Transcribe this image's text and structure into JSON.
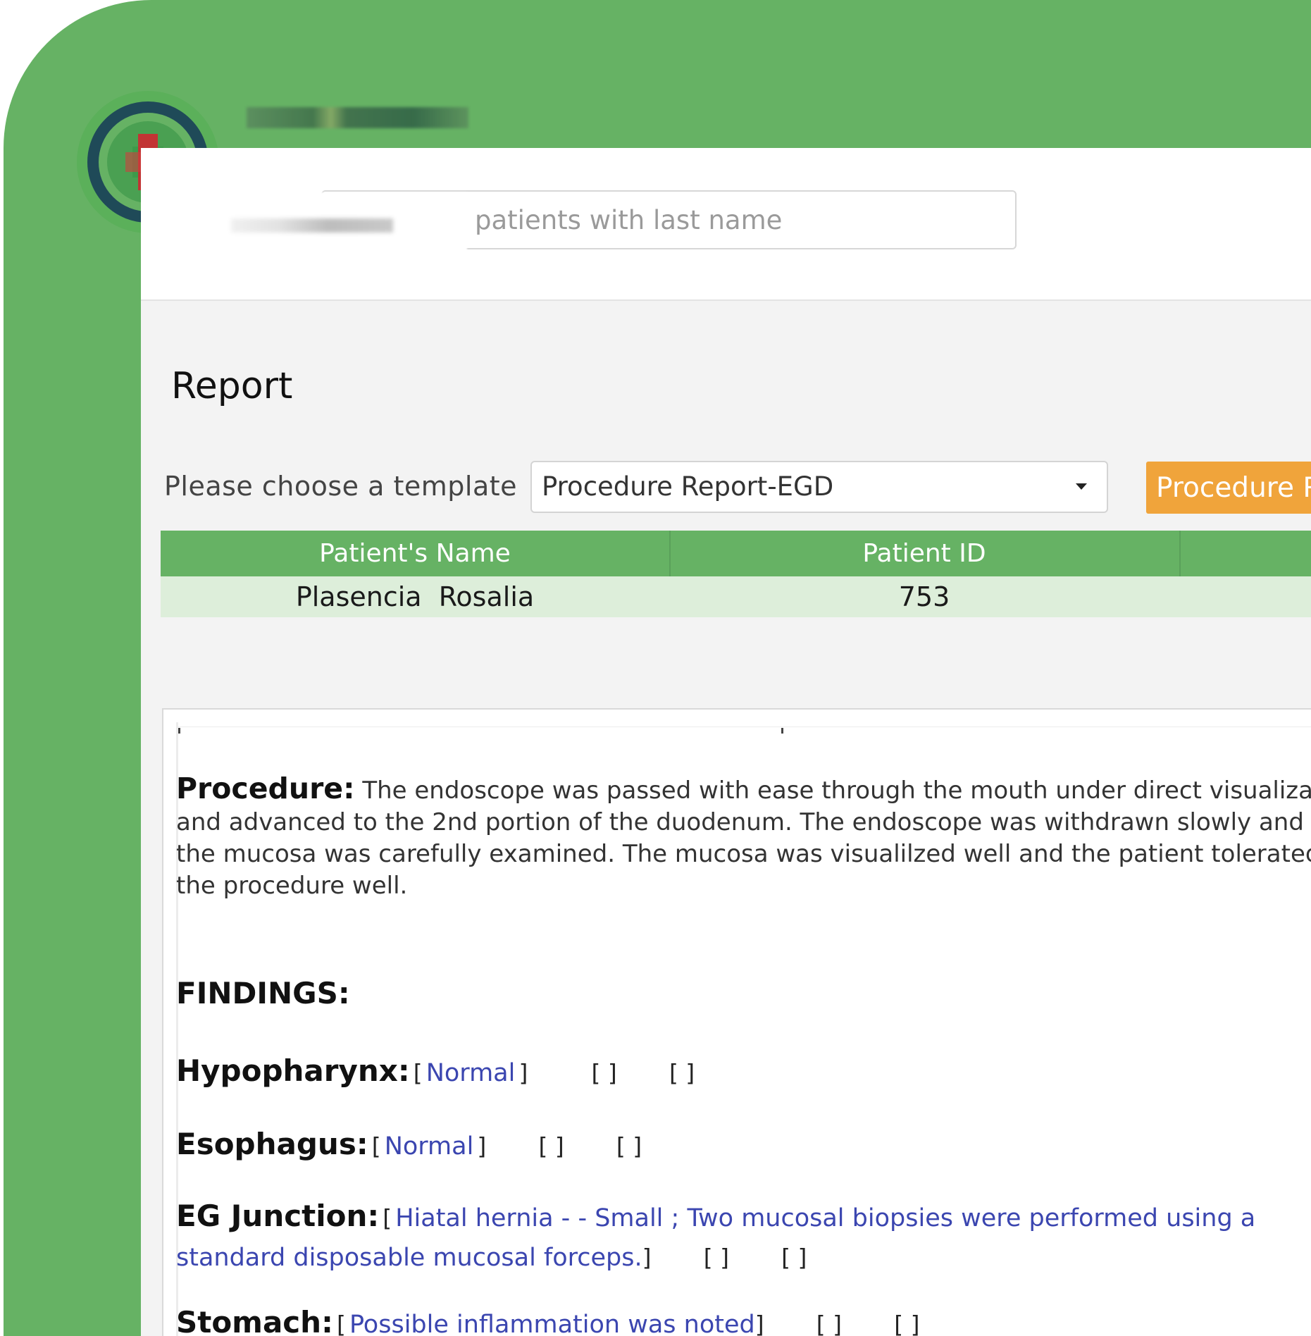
{
  "header": {
    "search_placeholder": "patients with last name"
  },
  "page": {
    "title": "Report"
  },
  "template": {
    "label": "Please choose a template",
    "selected": "Procedure Report-EGD",
    "button_label": "Procedure R"
  },
  "patient_table": {
    "columns": [
      "Patient's Name",
      "Patient ID",
      ""
    ],
    "rows": [
      {
        "name": "Plasencia  Rosalia",
        "id": "753"
      }
    ]
  },
  "report": {
    "procedure_label": "Procedure:",
    "procedure_lines": [
      "The endoscope was passed with ease through the mouth under direct visualization",
      "and advanced to the 2nd portion of the duodenum. The endoscope was withdrawn slowly and",
      "the mucosa was carefully examined. The mucosa was visualilzed well and the patient tolerated",
      "the procedure well."
    ],
    "findings_title": "FINDINGS:",
    "findings": [
      {
        "label": "Hypopharynx:",
        "value": "Normal",
        "open": "[",
        "close": "]",
        "empty1": "[  ]",
        "empty2": "[  ]"
      },
      {
        "label": "Esophagus:",
        "value": "Normal",
        "open": "[",
        "close": "]",
        "empty1": "[  ]",
        "empty2": "[  ]"
      },
      {
        "label": "EG Junction:",
        "value_line1": "Hiatal hernia -  - Small ; Two mucosal biopsies were performed using a",
        "value_line2": "standard disposable mucosal forceps.",
        "open": "[",
        "close": "]",
        "empty1": "[  ]",
        "empty2": "[  ]"
      },
      {
        "label": "Stomach:",
        "value": "Possible inflammation was noted",
        "open": "[",
        "close": "]",
        "empty1": "[  ]",
        "empty2": "[  ]"
      }
    ]
  },
  "colors": {
    "brand_green": "#66b264",
    "accent_orange": "#f0a43b",
    "finding_blue": "#3b46b0",
    "row_tint": "#ddeeda"
  }
}
